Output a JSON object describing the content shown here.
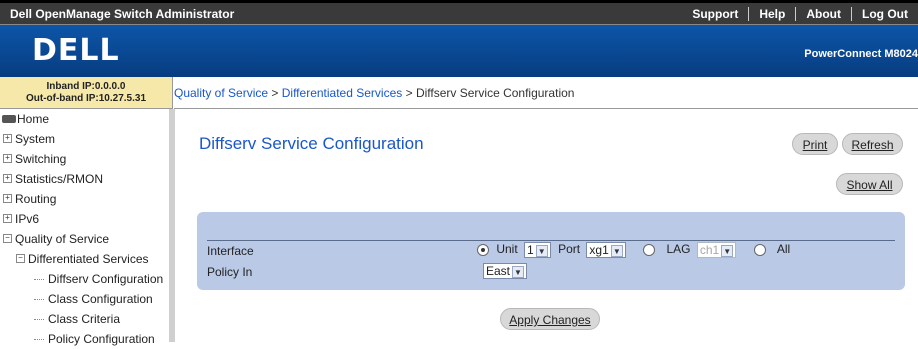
{
  "header": {
    "app_title": "Dell OpenManage Switch Administrator",
    "links": [
      "Support",
      "Help",
      "About",
      "Log Out"
    ]
  },
  "banner": {
    "logo": "DELL",
    "product": "PowerConnect M8024"
  },
  "ipinfo": {
    "inband": "Inband IP:0.0.0.0",
    "outband": "Out-of-band IP:10.27.5.31"
  },
  "breadcrumb": {
    "item1": "Quality of Service",
    "sep": " > ",
    "item2": "Differentiated Services",
    "current": "Diffserv Service Configuration"
  },
  "sidebar": {
    "items": [
      {
        "label": "Home"
      },
      {
        "label": "System"
      },
      {
        "label": "Switching"
      },
      {
        "label": "Statistics/RMON"
      },
      {
        "label": "Routing"
      },
      {
        "label": "IPv6"
      },
      {
        "label": "Quality of Service"
      },
      {
        "label": "Differentiated Services"
      },
      {
        "label": "Diffserv Configuration"
      },
      {
        "label": "Class Configuration"
      },
      {
        "label": "Class Criteria"
      },
      {
        "label": "Policy Configuration"
      }
    ],
    "expand_symbol": "+",
    "collapse_symbol": "−"
  },
  "main": {
    "title": "Diffserv Service Configuration",
    "print_label": "Print",
    "refresh_label": "Refresh",
    "show_all_label": "Show All",
    "apply_label": "Apply Changes"
  },
  "form": {
    "interface_label": "Interface",
    "policy_label": "Policy In",
    "unit_label": "Unit",
    "unit_value": "1",
    "port_label": "Port",
    "port_value": "xg1",
    "lag_label": "LAG",
    "lag_value": "ch1",
    "all_label": "All",
    "policy_value": "East",
    "selected_interface_type": "Unit"
  },
  "colors": {
    "banner": "#0a4b9a",
    "link": "#1a57c9",
    "panel": "#b9c9e6",
    "ipbox": "#f6e8a8"
  }
}
